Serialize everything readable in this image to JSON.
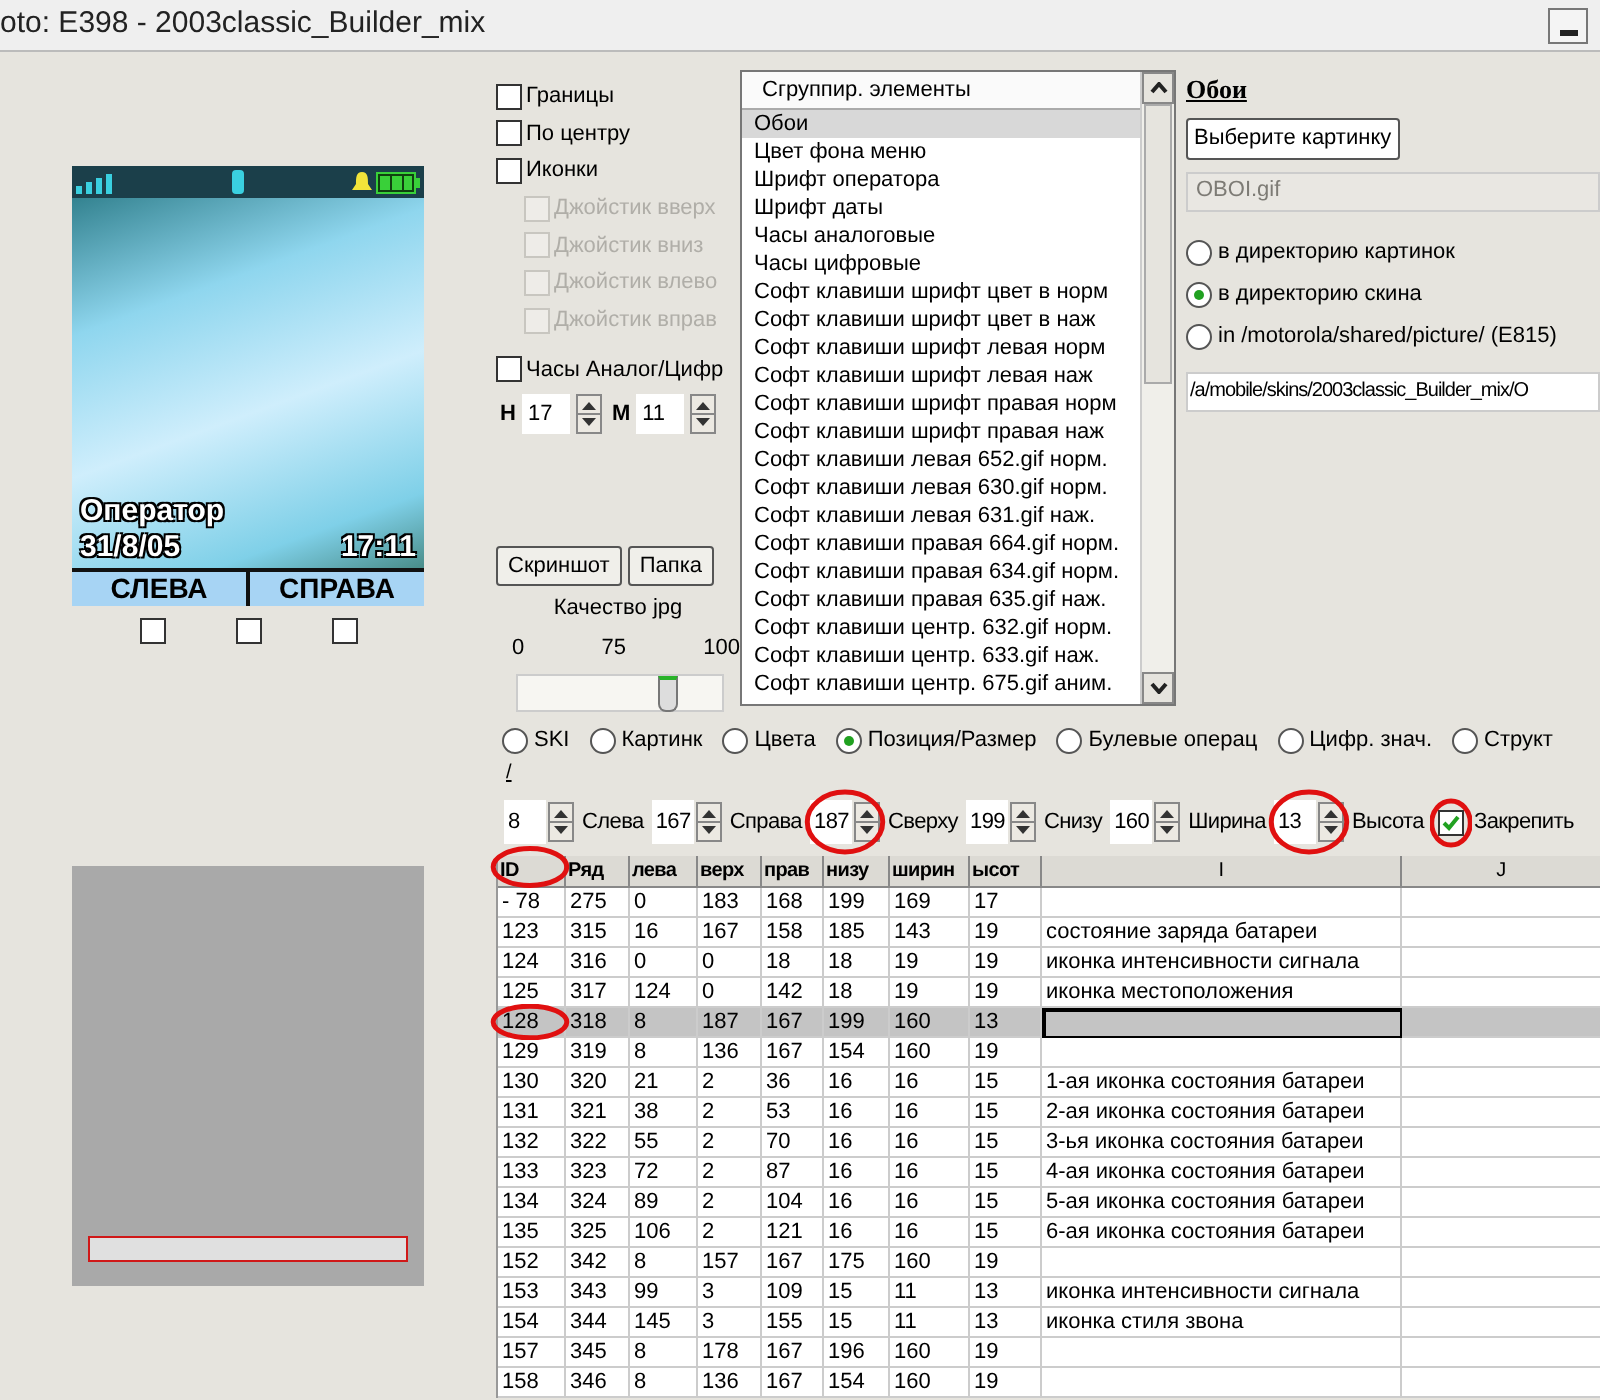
{
  "window": {
    "title": "oto: E398 - 2003classic_Builder_mix"
  },
  "preview": {
    "operator": "Оператор",
    "date": "31/8/05",
    "time": "17:11",
    "soft_left": "СЛЕВА",
    "soft_right": "СПРАВА",
    "key_checks": [
      {
        "checked": false
      },
      {
        "checked": false
      },
      {
        "checked": false
      }
    ],
    "progress": {
      "level": 0
    }
  },
  "options": [
    {
      "label": "Границы",
      "checked": false,
      "disabled": false
    },
    {
      "label": "По центру",
      "checked": false,
      "disabled": false
    },
    {
      "label": "Иконки",
      "checked": false,
      "disabled": false
    },
    {
      "label": "Джойстик вверх",
      "checked": false,
      "disabled": true
    },
    {
      "label": "Джойстик вниз",
      "checked": false,
      "disabled": true
    },
    {
      "label": "Джойстик влево",
      "checked": false,
      "disabled": true
    },
    {
      "label": "Джойстик вправ",
      "checked": false,
      "disabled": true
    }
  ],
  "clock": {
    "label": "Часы Аналог/Цифр",
    "checked": false
  },
  "clock_time": [
    {
      "label": "H",
      "value": "17"
    },
    {
      "label": "M",
      "value": "11"
    }
  ],
  "buttons": [
    "Скриншот",
    "Папка"
  ],
  "quality": {
    "label": "Качество jpg",
    "ticks": [
      "0",
      "75",
      "100"
    ],
    "level": 0.74
  },
  "element_list": {
    "header": "Сгруппир. элементы",
    "items": [
      {
        "label": "Обои",
        "selected": true
      },
      {
        "label": "Цвет фона меню",
        "selected": false
      },
      {
        "label": "Шрифт оператора",
        "selected": false
      },
      {
        "label": "Шрифт даты",
        "selected": false
      },
      {
        "label": "Часы аналоговые",
        "selected": false
      },
      {
        "label": "Часы цифровые",
        "selected": false
      },
      {
        "label": "Софт клавиши шрифт цвет в норм",
        "selected": false
      },
      {
        "label": "Софт клавиши шрифт цвет в наж",
        "selected": false
      },
      {
        "label": "Софт клавиши шрифт левая норм",
        "selected": false
      },
      {
        "label": "Софт клавиши шрифт левая наж",
        "selected": false
      },
      {
        "label": "Софт клавиши шрифт правая норм",
        "selected": false
      },
      {
        "label": "Софт клавиши шрифт правая наж",
        "selected": false
      },
      {
        "label": "Софт клавиши левая 652.gif норм.",
        "selected": false
      },
      {
        "label": "Софт клавиши левая 630.gif норм.",
        "selected": false
      },
      {
        "label": "Софт клавиши левая 631.gif наж.",
        "selected": false
      },
      {
        "label": "Софт клавиши правая 664.gif норм.",
        "selected": false
      },
      {
        "label": "Софт клавиши правая 634.gif норм.",
        "selected": false
      },
      {
        "label": "Софт клавиши правая 635.gif наж.",
        "selected": false
      },
      {
        "label": "Софт клавиши центр. 632.gif норм.",
        "selected": false
      },
      {
        "label": "Софт клавиши центр. 633.gif наж.",
        "selected": false
      },
      {
        "label": "Софт клавиши центр. 675.gif аним.",
        "selected": false
      }
    ]
  },
  "wallpaper": {
    "title": "Обои",
    "choose_button": "Выберите картинку",
    "file_field": {
      "value": "OBOI.gif",
      "disabled": true
    },
    "destinations": [
      {
        "label": "в директорию картинок",
        "selected": false
      },
      {
        "label": "в директорию скина",
        "selected": true
      },
      {
        "label": "in /motorola/shared/picture/ (E815)",
        "selected": false
      }
    ],
    "path": "/a/mobile/skins/2003classic_Builder_mix/O"
  },
  "tabs": [
    {
      "label": "SKI",
      "selected": false
    },
    {
      "label": "Картинк",
      "selected": false
    },
    {
      "label": "Цвета",
      "selected": false
    },
    {
      "label": "Позиция/Размер",
      "selected": true
    },
    {
      "label": "Булевые операц",
      "selected": false
    },
    {
      "label": "Цифр. знач.",
      "selected": false
    },
    {
      "label": "Структ",
      "selected": false
    }
  ],
  "tab_mark": "/",
  "position_bar": [
    {
      "kind": "field",
      "text": "8"
    },
    {
      "kind": "label",
      "text": "Слева"
    },
    {
      "kind": "field",
      "text": "167"
    },
    {
      "kind": "label",
      "text": "Справа"
    },
    {
      "kind": "field",
      "text": "187"
    },
    {
      "kind": "label",
      "text": "Сверху"
    },
    {
      "kind": "field",
      "text": "199"
    },
    {
      "kind": "label",
      "text": "Снизу"
    },
    {
      "kind": "field",
      "text": "160"
    },
    {
      "kind": "label",
      "text": "Ширина"
    },
    {
      "kind": "field",
      "text": "13"
    },
    {
      "kind": "label",
      "text": "Высота"
    }
  ],
  "lock": {
    "label": "Закрепить",
    "checked": true
  },
  "table": {
    "columns": [
      "ID",
      "Ряд",
      "лева",
      "верх",
      "прав",
      "низу",
      "ширин",
      "ысот",
      "I",
      "J"
    ],
    "rows": [
      {
        "cells": [
          "- 78",
          "275",
          "0",
          "183",
          "168",
          "199",
          "169",
          "17",
          ""
        ],
        "selected": false
      },
      {
        "cells": [
          "123",
          "315",
          "16",
          "167",
          "158",
          "185",
          "143",
          "19",
          "состояние заряда батареи"
        ],
        "selected": false
      },
      {
        "cells": [
          "124",
          "316",
          "0",
          "0",
          "18",
          "18",
          "19",
          "19",
          "иконка интенсивности сигнала"
        ],
        "selected": false
      },
      {
        "cells": [
          "125",
          "317",
          "124",
          "0",
          "142",
          "18",
          "19",
          "19",
          "иконка местоположения"
        ],
        "selected": false
      },
      {
        "cells": [
          "128",
          "318",
          "8",
          "187",
          "167",
          "199",
          "160",
          "13",
          ""
        ],
        "selected": true
      },
      {
        "cells": [
          "129",
          "319",
          "8",
          "136",
          "167",
          "154",
          "160",
          "19",
          ""
        ],
        "selected": false
      },
      {
        "cells": [
          "130",
          "320",
          "21",
          "2",
          "36",
          "16",
          "16",
          "15",
          "1-ая иконка состояния батареи"
        ],
        "selected": false
      },
      {
        "cells": [
          "131",
          "321",
          "38",
          "2",
          "53",
          "16",
          "16",
          "15",
          "2-ая иконка состояния батареи"
        ],
        "selected": false
      },
      {
        "cells": [
          "132",
          "322",
          "55",
          "2",
          "70",
          "16",
          "16",
          "15",
          "3-ья иконка состояния батареи"
        ],
        "selected": false
      },
      {
        "cells": [
          "133",
          "323",
          "72",
          "2",
          "87",
          "16",
          "16",
          "15",
          "4-ая иконка состояния батареи"
        ],
        "selected": false
      },
      {
        "cells": [
          "134",
          "324",
          "89",
          "2",
          "104",
          "16",
          "16",
          "15",
          "5-ая иконка состояния батареи"
        ],
        "selected": false
      },
      {
        "cells": [
          "135",
          "325",
          "106",
          "2",
          "121",
          "16",
          "16",
          "15",
          "6-ая иконка состояния батареи"
        ],
        "selected": false
      },
      {
        "cells": [
          "152",
          "342",
          "8",
          "157",
          "167",
          "175",
          "160",
          "19",
          ""
        ],
        "selected": false
      },
      {
        "cells": [
          "153",
          "343",
          "99",
          "3",
          "109",
          "15",
          "11",
          "13",
          "иконка интенсивности сигнала"
        ],
        "selected": false
      },
      {
        "cells": [
          "154",
          "344",
          "145",
          "3",
          "155",
          "15",
          "11",
          "13",
          "иконка стиля звона"
        ],
        "selected": false
      },
      {
        "cells": [
          "157",
          "345",
          "8",
          "178",
          "167",
          "196",
          "160",
          "19",
          ""
        ],
        "selected": false
      },
      {
        "cells": [
          "158",
          "346",
          "8",
          "136",
          "167",
          "154",
          "160",
          "19",
          ""
        ],
        "selected": false
      }
    ]
  }
}
